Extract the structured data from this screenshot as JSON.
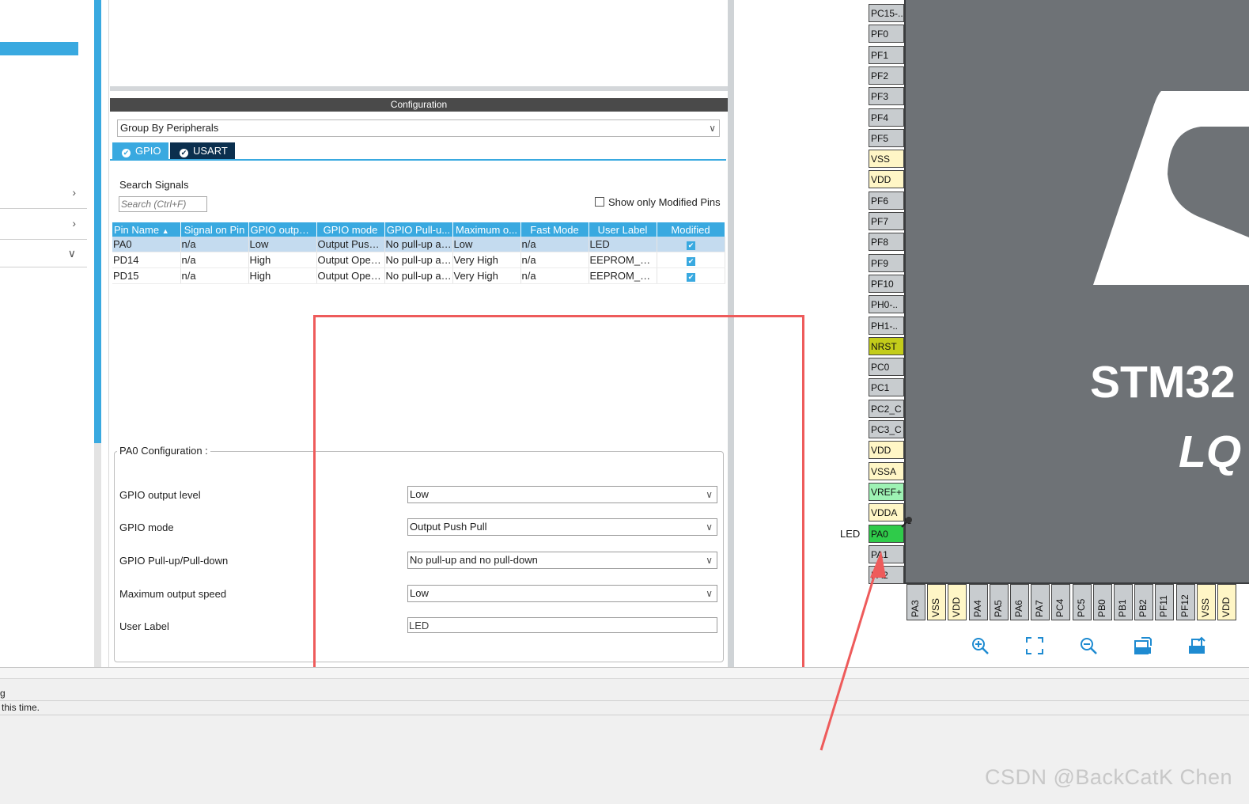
{
  "configuration": {
    "title": "Configuration",
    "group_by": "Group By Peripherals",
    "tabs": [
      {
        "label": "GPIO",
        "active": true
      },
      {
        "label": "USART",
        "active": false
      }
    ],
    "search_label": "Search Signals",
    "search_placeholder": "Search (Ctrl+F)",
    "show_modified_label": "Show only Modified Pins",
    "table": {
      "headers": [
        "Pin Name",
        "Signal on Pin",
        "GPIO output...",
        "GPIO mode",
        "GPIO Pull-u...",
        "Maximum o...",
        "Fast Mode",
        "User Label",
        "Modified"
      ],
      "rows": [
        {
          "pin": "PA0",
          "signal": "n/a",
          "output": "Low",
          "mode": "Output Push Pull",
          "pull": "No pull-up and no pull-down",
          "speed": "Low",
          "fast": "n/a",
          "label": "LED",
          "modified": true
        },
        {
          "pin": "PD14",
          "signal": "n/a",
          "output": "High",
          "mode": "Output Open Drain",
          "pull": "No pull-up and no pull-down",
          "speed": "Very High",
          "fast": "n/a",
          "label": "EEPROM_SCL",
          "modified": true
        },
        {
          "pin": "PD15",
          "signal": "n/a",
          "output": "High",
          "mode": "Output Open Drain",
          "pull": "No pull-up and no pull-down",
          "speed": "Very High",
          "fast": "n/a",
          "label": "EEPROM_SDA",
          "modified": true
        }
      ]
    },
    "pin_config": {
      "legend": "PA0 Configuration :",
      "fields": [
        {
          "label": "GPIO output level",
          "value": "Low"
        },
        {
          "label": "GPIO mode",
          "value": "Output Push Pull"
        },
        {
          "label": "GPIO Pull-up/Pull-down",
          "value": "No pull-up and no pull-down"
        },
        {
          "label": "Maximum output speed",
          "value": "Low"
        }
      ],
      "user_label": {
        "label": "User Label",
        "value": "LED"
      }
    }
  },
  "console": {
    "line1": "g",
    "line2": "this time."
  },
  "chip": {
    "name": "STM32",
    "package": "LQ",
    "left_pins": [
      {
        "name": "PC15-..",
        "color": "#c8cccf"
      },
      {
        "name": "PF0",
        "color": "#c8cccf"
      },
      {
        "name": "PF1",
        "color": "#c8cccf"
      },
      {
        "name": "PF2",
        "color": "#c8cccf"
      },
      {
        "name": "PF3",
        "color": "#c8cccf"
      },
      {
        "name": "PF4",
        "color": "#c8cccf"
      },
      {
        "name": "PF5",
        "color": "#c8cccf"
      },
      {
        "name": "VSS",
        "color": "#fff6c6"
      },
      {
        "name": "VDD",
        "color": "#fff6c6"
      },
      {
        "name": "PF6",
        "color": "#c8cccf"
      },
      {
        "name": "PF7",
        "color": "#c8cccf"
      },
      {
        "name": "PF8",
        "color": "#c8cccf"
      },
      {
        "name": "PF9",
        "color": "#c8cccf"
      },
      {
        "name": "PF10",
        "color": "#c8cccf"
      },
      {
        "name": "PH0-..",
        "color": "#c8cccf"
      },
      {
        "name": "PH1-..",
        "color": "#c8cccf"
      },
      {
        "name": "NRST",
        "color": "#c3cc1a"
      },
      {
        "name": "PC0",
        "color": "#c8cccf"
      },
      {
        "name": "PC1",
        "color": "#c8cccf"
      },
      {
        "name": "PC2_C",
        "color": "#c8cccf"
      },
      {
        "name": "PC3_C",
        "color": "#c8cccf"
      },
      {
        "name": "VDD",
        "color": "#fff6c6"
      },
      {
        "name": "VSSA",
        "color": "#fff6c6"
      },
      {
        "name": "VREF+",
        "color": "#9ef2b4"
      },
      {
        "name": "VDDA",
        "color": "#fff6c6"
      },
      {
        "name": "PA0",
        "color": "#2fcb4a"
      },
      {
        "name": "PA1",
        "color": "#c8cccf"
      },
      {
        "name": "PA2",
        "color": "#c8cccf"
      }
    ],
    "bottom_pins": [
      {
        "name": "PA3",
        "color": "#c8cccf"
      },
      {
        "name": "VSS",
        "color": "#fff6c6"
      },
      {
        "name": "VDD",
        "color": "#fff6c6"
      },
      {
        "name": "PA4",
        "color": "#c8cccf"
      },
      {
        "name": "PA5",
        "color": "#c8cccf"
      },
      {
        "name": "PA6",
        "color": "#c8cccf"
      },
      {
        "name": "PA7",
        "color": "#c8cccf"
      },
      {
        "name": "PC4",
        "color": "#c8cccf"
      },
      {
        "name": "PC5",
        "color": "#c8cccf"
      },
      {
        "name": "PB0",
        "color": "#c8cccf"
      },
      {
        "name": "PB1",
        "color": "#c8cccf"
      },
      {
        "name": "PB2",
        "color": "#c8cccf"
      },
      {
        "name": "PF11",
        "color": "#c8cccf"
      },
      {
        "name": "PF12",
        "color": "#c8cccf"
      },
      {
        "name": "VSS",
        "color": "#fff6c6"
      },
      {
        "name": "VDD",
        "color": "#fff6c6"
      }
    ],
    "pin_label": "LED",
    "toolbar": [
      "zoom-in-icon",
      "fit-screen-icon",
      "zoom-out-icon",
      "export-icon",
      "rotate-icon"
    ]
  },
  "watermark": "CSDN @BackCatK Chen",
  "colors": {
    "accent": "#39a9e0",
    "tab_dark": "#0b2f4e",
    "highlight": "#ee5b5b"
  }
}
